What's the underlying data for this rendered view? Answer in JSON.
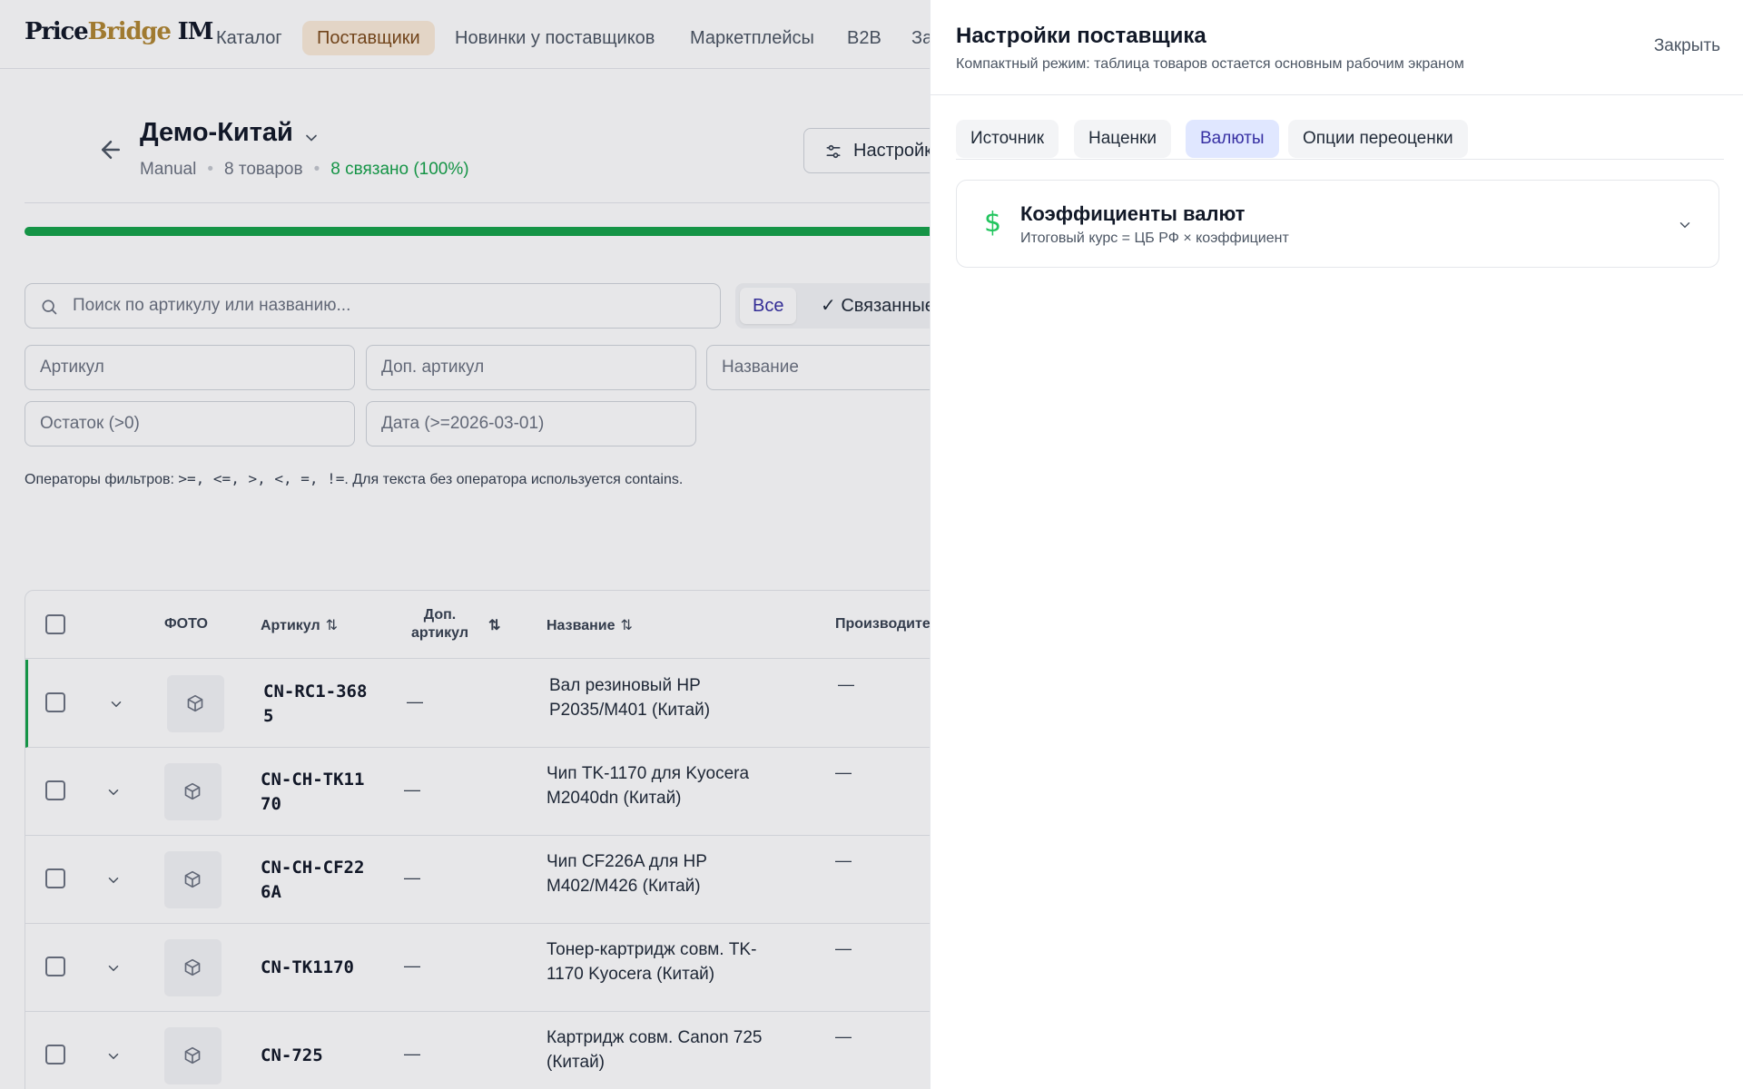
{
  "logo": {
    "part1": "Price",
    "part2": "Bridge",
    "part3": " IM"
  },
  "nav": {
    "items": [
      {
        "label": "Каталог"
      },
      {
        "label": "Поставщики"
      },
      {
        "label": "Новинки у поставщиков"
      },
      {
        "label": "Маркетплейсы"
      },
      {
        "label": "B2B"
      },
      {
        "label": "За"
      }
    ],
    "active_index": 1
  },
  "supplier": {
    "title": "Демо-Китай",
    "mode": "Manual",
    "products_count": "8 товаров",
    "linked": "8 связано (100%)",
    "settings_label": "Настройки",
    "progress_percent": 100
  },
  "search": {
    "placeholder": "Поиск по артикулу или названию..."
  },
  "filter_segments": {
    "all": "Все",
    "linked": "✓ Связанные"
  },
  "filters": {
    "sku": "Артикул",
    "alt_sku": "Доп. артикул",
    "name": "Название",
    "stock": "Остаток (>0)",
    "date": "Дата (>=2026-03-01)"
  },
  "hint": {
    "prefix": "Операторы фильтров: ",
    "ops": ">=, <=, >, <, =, !=",
    "suffix": ". Для текста без оператора используется contains."
  },
  "table": {
    "headers": {
      "photo": "ФОТО",
      "sku": "Артикул",
      "alt_sku_line1": "Доп.",
      "alt_sku_line2": "артикул",
      "name": "Название",
      "manufacturer": "Производитель"
    },
    "rows": [
      {
        "sku": "CN-RC1-3685",
        "alt_sku": "—",
        "name": "Вал резиновый HP P2035/M401 (Китай)",
        "manufacturer": "—"
      },
      {
        "sku": "CN-CH-TK1170",
        "alt_sku": "—",
        "name": "Чип TK-1170 для Kyocera M2040dn (Китай)",
        "manufacturer": "—"
      },
      {
        "sku": "CN-CH-CF226A",
        "alt_sku": "—",
        "name": "Чип CF226A для HP M402/M426 (Китай)",
        "manufacturer": "—"
      },
      {
        "sku": "CN-TK1170",
        "alt_sku": "—",
        "name": "Тонер-картридж совм. TK-1170 Kyocera (Китай)",
        "manufacturer": "—"
      },
      {
        "sku": "CN-725",
        "alt_sku": "—",
        "name": "Картридж совм. Canon 725 (Китай)",
        "manufacturer": "—"
      }
    ]
  },
  "drawer": {
    "title": "Настройки поставщика",
    "subtitle": "Компактный режим: таблица товаров остается основным рабочим экраном",
    "close_label": "Закрыть",
    "tabs": [
      {
        "label": "Источник"
      },
      {
        "label": "Наценки"
      },
      {
        "label": "Валюты"
      },
      {
        "label": "Опции переоценки"
      }
    ],
    "active_tab_index": 2,
    "accordion": {
      "icon": "dollar-icon",
      "title": "Коэффициенты валют",
      "subtitle": "Итоговый курс = ЦБ РФ × коэффициент"
    }
  },
  "colors": {
    "accent_green": "#16a34a",
    "active_nav_bg": "#fbebd8",
    "active_tab_bg": "#e0e7ff",
    "logo_accent": "#b08632"
  }
}
